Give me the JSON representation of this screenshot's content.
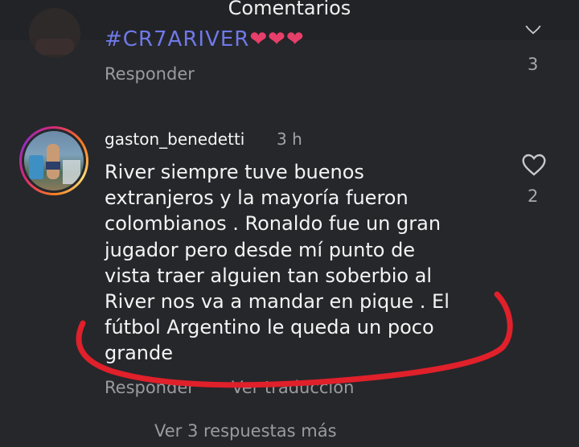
{
  "header": {
    "title": "Comentarios"
  },
  "previous_comment": {
    "text": "#CR7ARIVER",
    "hearts": "❤❤❤",
    "reply_label": "Responder",
    "like_count": "3"
  },
  "comment": {
    "username": "gaston_benedetti",
    "time": "3 h",
    "text": "River siempre tuve buenos\nextranjeros y la mayoría fueron\ncolombianos . Ronaldo fue un gran\njugador pero desde mí punto de\nvista traer alguien tan soberbio al\nRiver nos va a mandar en pique . El\nfútbol Argentino le queda un poco\ngrande",
    "like_count": "2",
    "reply_label": "Responder",
    "translate_label": "Ver traducción",
    "view_replies_label": "Ver 3 respuestas más"
  },
  "colors": {
    "background": "#26272b",
    "hashtag": "#6f79e8",
    "annotation_stroke": "#e0202a"
  }
}
